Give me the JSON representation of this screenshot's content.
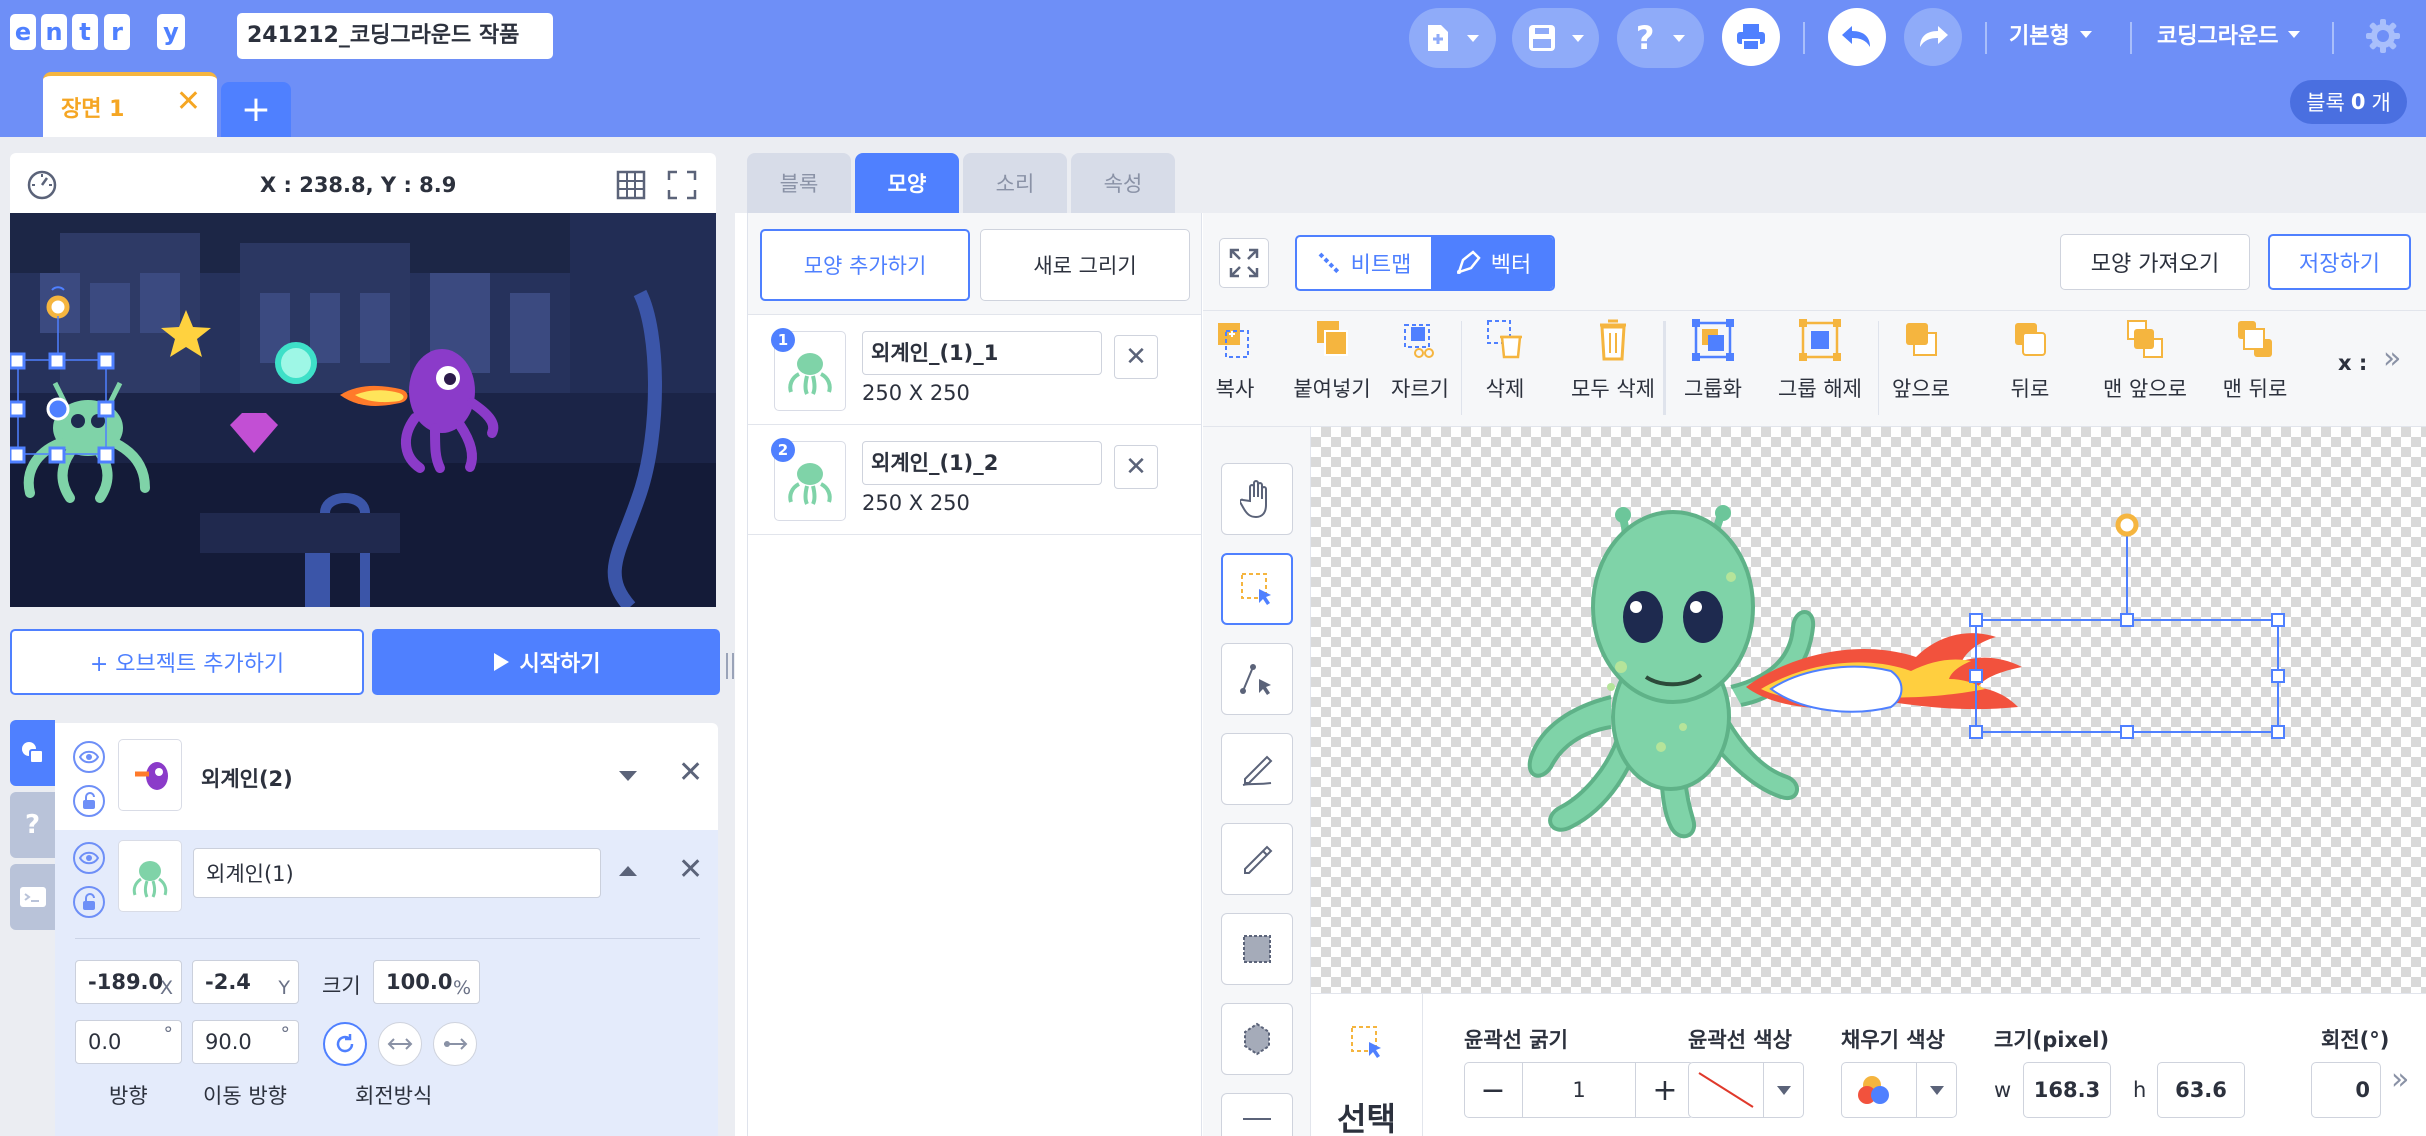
{
  "header": {
    "logo_letters": [
      "e",
      "n",
      "t",
      "r",
      "y"
    ],
    "project_title": "241212_코딩그라운드 작품",
    "menu_basic": "기본형",
    "menu_user": "코딩그라운드",
    "scene_tab": "장면 1",
    "scene_close": "✕",
    "scene_add": "+",
    "block_count_label": "블록",
    "block_count_value": "0",
    "block_count_unit": "개",
    "icons": [
      "new-file-icon",
      "save-icon",
      "help-icon",
      "print-icon",
      "undo-icon",
      "redo-icon",
      "settings-icon"
    ]
  },
  "stage": {
    "coordinates": "X : 238.8, Y : 8.9",
    "add_object_label": "+ 오브젝트 추가하기",
    "start_label": "시작하기"
  },
  "objects": [
    {
      "name": "외계인(2)",
      "expanded": false
    },
    {
      "name": "외계인(1)",
      "expanded": true
    }
  ],
  "selected_object": {
    "x": "-189.0",
    "x_unit": "X",
    "y": "-2.4",
    "y_unit": "Y",
    "size_label": "크기",
    "size": "100.0",
    "size_unit": "%",
    "direction": "0.0",
    "direction_unit": "°",
    "move_direction": "90.0",
    "move_direction_unit": "°",
    "direction_label": "방향",
    "move_direction_label": "이동 방향",
    "rotation_label": "회전방식"
  },
  "tabs": [
    "블록",
    "모양",
    "소리",
    "속성"
  ],
  "active_tab": "모양",
  "costume_panel": {
    "add_costume": "모양 추가하기",
    "new_draw": "새로 그리기",
    "items": [
      {
        "num": "1",
        "name": "외계인_(1)_1",
        "size": "250 X 250"
      },
      {
        "num": "2",
        "name": "외계인_(1)_2",
        "size": "250 X 250"
      }
    ]
  },
  "editor": {
    "bitmap": "비트맵",
    "vector": "벡터",
    "import": "모양 가져오기",
    "save": "저장하기",
    "tools": [
      "복사",
      "붙여넣기",
      "자르기",
      "삭제",
      "모두 삭제",
      "그룹화",
      "그룹 해제",
      "앞으로",
      "뒤로",
      "맨 앞으로",
      "맨 뒤로"
    ],
    "x_label": "x :",
    "selected_tool": "선택",
    "stroke_width_label": "윤곽선 굵기",
    "stroke_width": "1",
    "stroke_color_label": "윤곽선 색상",
    "fill_color_label": "채우기 색상",
    "size_label": "크기(pixel)",
    "w_label": "w",
    "w": "168.3",
    "h_label": "h",
    "h": "63.6",
    "rotation_label": "회전(°)",
    "rotation": "0"
  },
  "colors": {
    "header_bg": "#6e8ff7",
    "accent": "#4f80ff",
    "scene_tab": "#f5a623",
    "panel_bg": "#ebedf2"
  }
}
